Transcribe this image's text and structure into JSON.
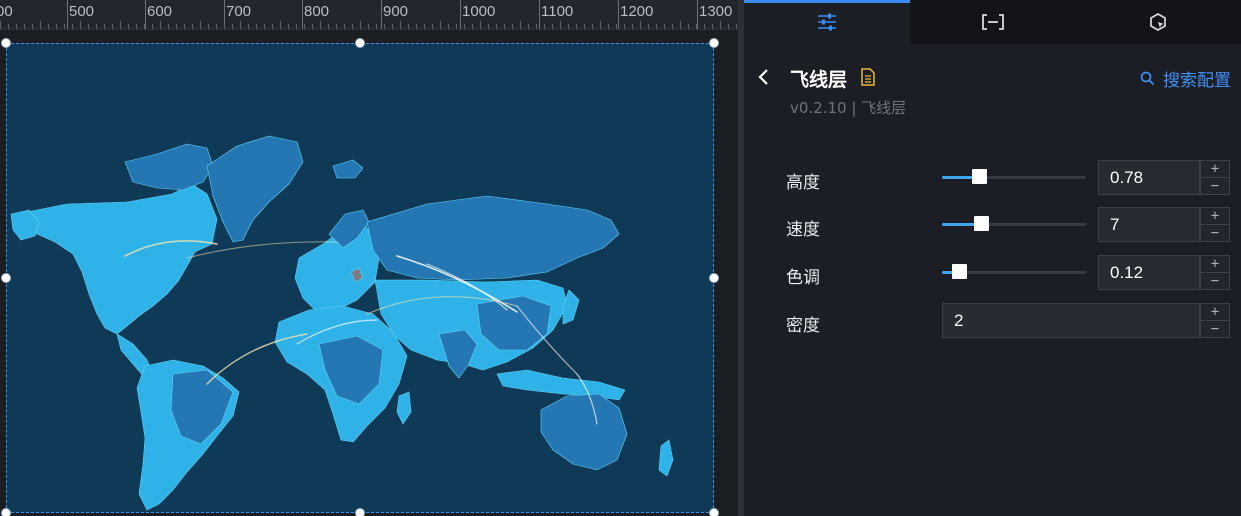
{
  "ruler": {
    "labels": [
      "00",
      "500",
      "600",
      "700",
      "800",
      "900",
      "1000",
      "1100",
      "1200",
      "1300"
    ]
  },
  "panel": {
    "tabs": [
      {
        "name": "tab-style",
        "icon": "sliders-icon",
        "active": true
      },
      {
        "name": "tab-data",
        "icon": "bracket-icon",
        "active": false
      },
      {
        "name": "tab-interaction",
        "icon": "cursor-hexagon-icon",
        "active": false
      }
    ],
    "title": "飞线层",
    "version": "v0.2.10 | 飞线层",
    "search_label": "搜索配置",
    "fields": [
      {
        "label": "高度",
        "value": "0.78",
        "slider": true,
        "level": 0.26
      },
      {
        "label": "速度",
        "value": "7",
        "slider": true,
        "level": 0.27
      },
      {
        "label": "色调",
        "value": "0.12",
        "slider": true,
        "level": 0.12
      },
      {
        "label": "密度",
        "value": "2",
        "slider": false
      }
    ],
    "stepper": {
      "up": "+",
      "down": "−"
    }
  },
  "colors": {
    "accent": "#3b8bf5",
    "map_background": "#0f3a57",
    "land_light": "#2fb2e8",
    "land_dark": "#2577b4",
    "fly_line": "#f0e6b0"
  }
}
